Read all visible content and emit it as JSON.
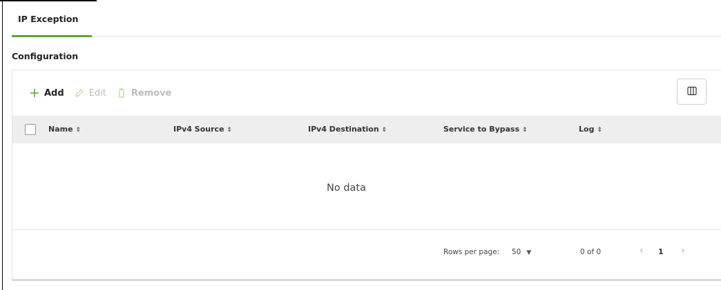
{
  "tabs": [
    {
      "label": "IP Exception",
      "active": true
    }
  ],
  "section": {
    "title": "Configuration"
  },
  "toolbar": {
    "add_label": "Add",
    "edit_label": "Edit",
    "remove_label": "Remove"
  },
  "table": {
    "columns": [
      "Name",
      "IPv4 Source",
      "IPv4 Destination",
      "Service to Bypass",
      "Log"
    ],
    "rows": [],
    "empty_text": "No data"
  },
  "pagination": {
    "rows_per_page_label": "Rows per page:",
    "rows_per_page_value": "50",
    "range_text": "0 of 0",
    "current_page": "1"
  },
  "colors": {
    "accent": "#5aa630",
    "header_bg": "#eeeeee",
    "disabled_text": "#bdbdbd"
  },
  "icons": {
    "add": "plus-icon",
    "edit": "pencil-icon",
    "remove": "trash-icon",
    "columns": "columns-icon",
    "sort": "sort-icon",
    "prev": "chevron-left-icon",
    "next": "chevron-right-icon",
    "dropdown": "caret-down-icon"
  }
}
